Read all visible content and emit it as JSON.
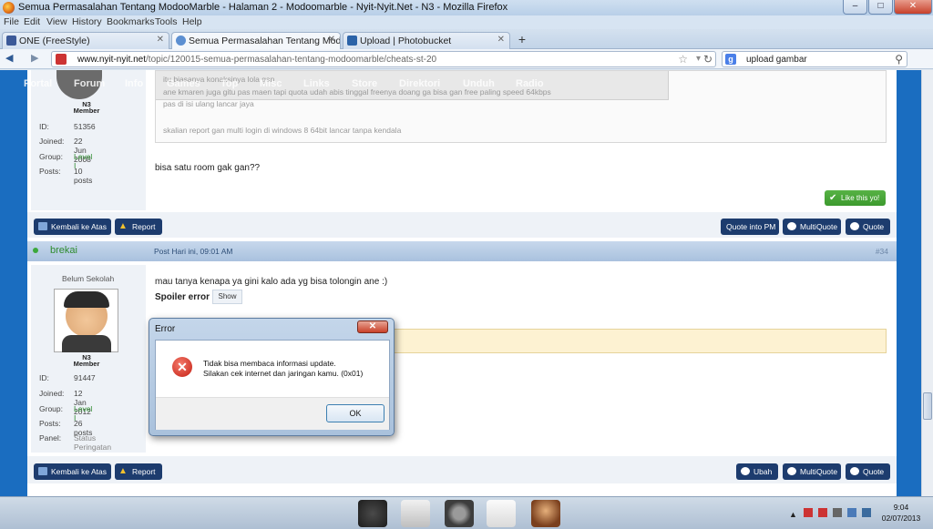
{
  "window": {
    "title": "Semua Permasalahan Tentang ModooMarble - Halaman 2 - Modoomarble - Nyit-Nyit.Net - N3 - Mozilla Firefox",
    "minimize": "–",
    "maximize": "□",
    "close": "✕"
  },
  "menubar": [
    "File",
    "Edit",
    "View",
    "History",
    "Bookmarks",
    "Tools",
    "Help"
  ],
  "tabs": [
    {
      "label": "ONE (FreeStyle)",
      "close": "✕"
    },
    {
      "label": "Semua Permasalahan Tentang Modoo...",
      "close": "✕"
    },
    {
      "label": "Upload | Photobucket",
      "close": "✕"
    }
  ],
  "newtab": "+",
  "nav": {
    "back": "◀",
    "forward": "▶",
    "url_domain": "www.nyit-nyit.net",
    "url_path": "/topic/120015-semua-permasalahan-tentang-modoomarble/cheats-st-20",
    "search_engine": "g",
    "search_value": "upload gambar"
  },
  "site_nav": [
    "Portal",
    "Forum",
    "Info",
    "Games",
    "Top",
    "Misc",
    "Links",
    "Store",
    "Direktori",
    "Unduh",
    "Radio"
  ],
  "post1": {
    "quote_lines": [
      "itu biasanya konaksinya lola gan",
      "ane kmaren juga gitu pas maen tapi quota udah abis tinggal freenya doang ga bisa gan free paling speed 64kbps",
      "pas di isi ulang lancar jaya",
      "skalian report gan multi login di windows 8 64bit lancar tanpa kendala"
    ],
    "text": "bisa satu room gak gan??",
    "like": "Like this yo!",
    "badge": "N3 Member",
    "profile": [
      [
        "ID:",
        "51356"
      ],
      [
        "Joined:",
        "22 Jun 2008"
      ],
      [
        "Group:",
        "Level I"
      ],
      [
        "Posts:",
        "10 posts"
      ]
    ],
    "buttons": {
      "back": "Kembali ke Atas",
      "report": "Report",
      "quote_pm": "Quote into PM",
      "multiquote": "MultiQuote",
      "quote": "Quote"
    }
  },
  "post2": {
    "username": "brekai",
    "date": "Post Hari ini, 09:01 AM",
    "number": "#34",
    "rank": "Belum Sekolah",
    "badge": "N3 Member",
    "text": "mau tanya kenapa ya gini kalo ada yg bisa tolongin ane :)",
    "spoiler_label": "Spoiler error",
    "spoiler_btn": "Show",
    "profile": [
      [
        "ID:",
        "91447"
      ],
      [
        "Joined:",
        "12 Jan 2012"
      ],
      [
        "Group:",
        "Level I"
      ],
      [
        "Posts:",
        "26 posts"
      ],
      [
        "Panel:",
        "Status Peringatan"
      ]
    ],
    "buttons": {
      "back": "Kembali ke Atas",
      "report": "Report",
      "ubah": "Ubah",
      "multiquote": "MultiQuote",
      "quote": "Quote"
    }
  },
  "dialog": {
    "title": "Error",
    "close": "✕",
    "line1": "Tidak bisa membaca informasi update.",
    "line2": "Silakan cek internet dan jaringan kamu. (0x01)",
    "ok": "OK"
  },
  "taskbar": {
    "time": "9:04",
    "date": "02/07/2013"
  },
  "colors": {
    "accent": "#1a6dc0",
    "button": "#1d3c6e",
    "like": "#3c9a2e",
    "username": "#2e8b2e"
  }
}
